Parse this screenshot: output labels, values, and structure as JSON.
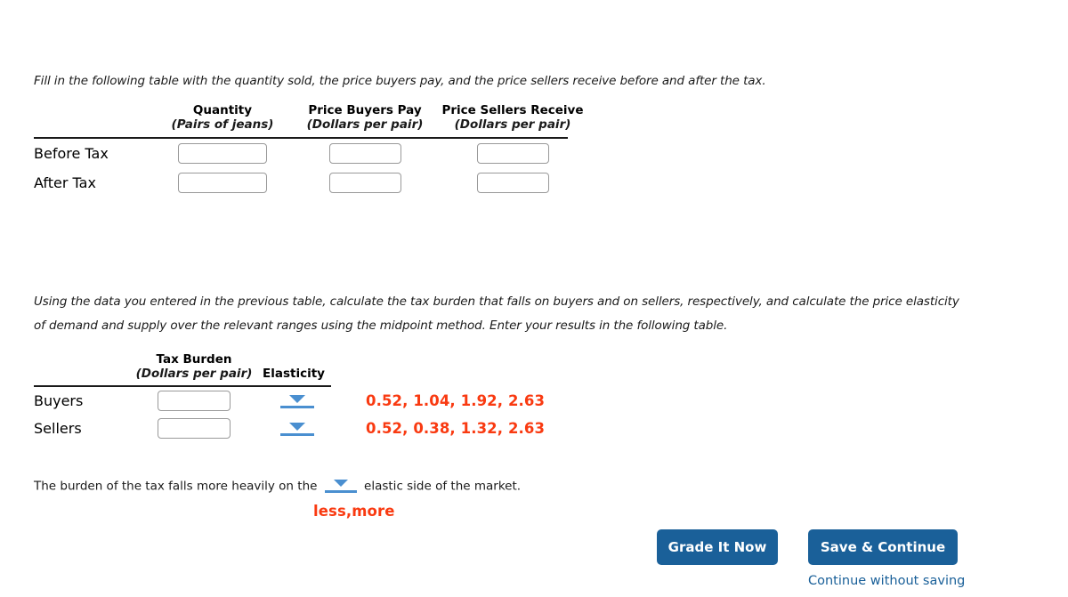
{
  "prompts": {
    "first": "Fill in the following table with the quantity sold, the price buyers pay, and the price sellers receive before and after the tax.",
    "second": "Using the data you entered in the previous table, calculate the tax burden that falls on buyers and on sellers, respectively, and calculate the price elasticity of demand and supply over the relevant ranges using the midpoint method. Enter your results in the following table."
  },
  "table1": {
    "columns": [
      {
        "title": "Quantity",
        "unit": "(Pairs of jeans)"
      },
      {
        "title": "Price Buyers Pay",
        "unit": "(Dollars per pair)"
      },
      {
        "title": "Price Sellers Receive",
        "unit": "(Dollars per pair)"
      }
    ],
    "rows": [
      {
        "label": "Before Tax",
        "values": [
          "",
          "",
          ""
        ]
      },
      {
        "label": "After Tax",
        "values": [
          "",
          "",
          ""
        ]
      }
    ]
  },
  "table2": {
    "columns": [
      {
        "title": "Tax Burden",
        "unit": "(Dollars per pair)"
      },
      {
        "title": "Elasticity",
        "unit": ""
      }
    ],
    "rows": [
      {
        "label": "Buyers",
        "burden_value": "",
        "elasticity_selected": "",
        "elasticity_options": "0.52, 1.04, 1.92, 2.63"
      },
      {
        "label": "Sellers",
        "burden_value": "",
        "elasticity_selected": "",
        "elasticity_options": "0.52, 0.38, 1.32, 2.63"
      }
    ]
  },
  "conclusion": {
    "text_before": "The burden of the tax falls more heavily on the",
    "text_after": "elastic side of the market.",
    "selected": "",
    "options": "less,more"
  },
  "footer": {
    "grade_label": "Grade It Now",
    "save_label": "Save & Continue",
    "continue_link": "Continue without saving"
  },
  "colors": {
    "button_blue": "#1a6099",
    "option_red": "#f93a11",
    "dropdown_blue": "#4a8fd0",
    "input_border": "#999999"
  }
}
